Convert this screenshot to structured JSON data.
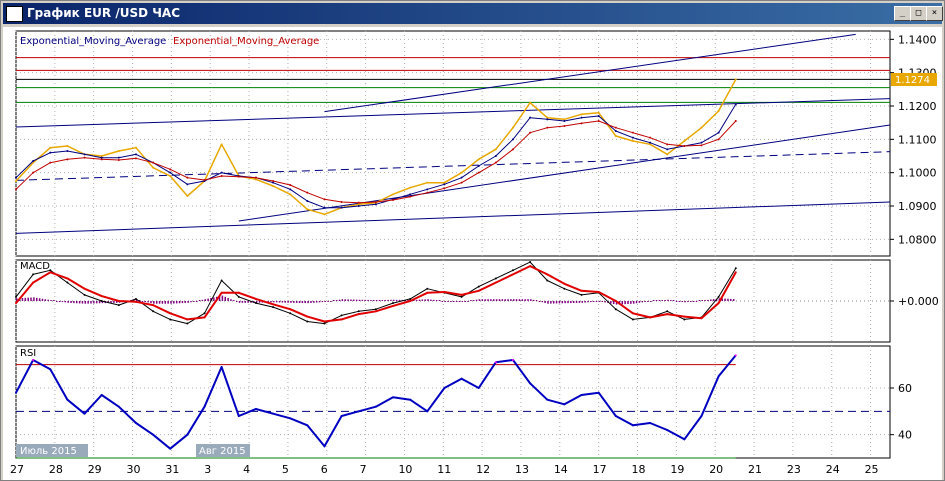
{
  "window": {
    "title": "График EUR /USD  ЧАС",
    "buttons": [
      "_",
      "□",
      "×"
    ]
  },
  "legend": {
    "ema1": "Exponential_Moving_Average",
    "ema2": "Exponential_Moving_Average"
  },
  "price_tag": "1.1274",
  "macd_label": "MACD",
  "rsi_label": "RSI",
  "month_labels": [
    "Июль 2015",
    "Авг 2015"
  ],
  "colors": {
    "price": "#e8a800",
    "ema_fast": "#000080",
    "ema_slow": "#c00000",
    "trend": "#000080",
    "macd_hist": "#800080",
    "rsi": "#0000c0",
    "rsi_extreme": "#ff00ff",
    "resist": "#c00000",
    "support": "#008000"
  },
  "chart_data": [
    {
      "type": "line",
      "name": "main",
      "ylim": [
        1.075,
        1.1425
      ],
      "yticks": [
        1.08,
        1.09,
        1.1,
        1.11,
        1.12,
        1.13,
        1.14
      ],
      "ytick_labels": [
        "1.0800",
        "1.0900",
        "1.1000",
        "1.1100",
        "1.1200",
        "1.1300",
        "1.1400"
      ],
      "horizontal_lines": [
        {
          "y": 1.1345,
          "color": "#c00000"
        },
        {
          "y": 1.1307,
          "color": "#c00000"
        },
        {
          "y": 1.128,
          "color": "#000000"
        },
        {
          "y": 1.1255,
          "color": "#008000"
        },
        {
          "y": 1.1211,
          "color": "#008000"
        }
      ],
      "trendlines": [
        {
          "x1": 0,
          "y1": 1.1137,
          "x2": 25.5,
          "y2": 1.1222,
          "dash": false
        },
        {
          "x1": 9,
          "y1": 1.1183,
          "x2": 24.5,
          "y2": 1.1415,
          "dash": false
        },
        {
          "x1": 0,
          "y1": 1.0818,
          "x2": 25.5,
          "y2": 1.0912,
          "dash": false
        },
        {
          "x1": 0,
          "y1": 1.0977,
          "x2": 25.5,
          "y2": 1.1063,
          "dash": true
        },
        {
          "x1": 6.5,
          "y1": 1.0855,
          "x2": 25.5,
          "y2": 1.1143,
          "dash": false
        }
      ],
      "x": [
        0,
        0.5,
        1,
        1.5,
        2,
        2.5,
        3,
        3.5,
        4,
        4.5,
        5,
        5.5,
        6,
        6.5,
        7,
        7.5,
        8,
        8.5,
        9,
        9.5,
        10,
        10.5,
        11,
        11.5,
        12,
        12.5,
        13,
        13.5,
        14,
        14.5,
        15,
        15.5,
        16,
        16.5,
        17,
        17.5,
        18,
        18.5,
        19,
        19.5,
        20,
        20.5,
        21
      ],
      "series": [
        {
          "values": [
            1.0975,
            1.103,
            1.1075,
            1.108,
            1.1055,
            1.105,
            1.1065,
            1.1075,
            1.1015,
            1.099,
            1.093,
            1.0975,
            1.1085,
            1.099,
            1.098,
            1.096,
            1.0935,
            1.089,
            1.0875,
            1.0895,
            1.0905,
            1.091,
            1.0935,
            1.0955,
            1.097,
            1.097,
            1.1,
            1.104,
            1.107,
            1.1135,
            1.121,
            1.1165,
            1.116,
            1.1175,
            1.118,
            1.111,
            1.1095,
            1.1085,
            1.1055,
            1.1095,
            1.1135,
            1.1185,
            1.128
          ]
        },
        {
          "values": [
            1.0985,
            1.1035,
            1.106,
            1.1065,
            1.1055,
            1.1045,
            1.1045,
            1.1055,
            1.103,
            1.1,
            1.0965,
            1.0975,
            1.1,
            1.099,
            1.0985,
            1.097,
            1.095,
            1.0915,
            1.0895,
            1.0895,
            1.09,
            1.0905,
            1.092,
            1.0935,
            1.095,
            1.0965,
            1.0985,
            1.102,
            1.105,
            1.11,
            1.1165,
            1.116,
            1.1155,
            1.1165,
            1.117,
            1.1125,
            1.1105,
            1.109,
            1.107,
            1.108,
            1.109,
            1.112,
            1.1205
          ]
        },
        {
          "values": [
            1.095,
            1.1,
            1.103,
            1.104,
            1.1045,
            1.104,
            1.1038,
            1.1043,
            1.103,
            1.101,
            1.0985,
            1.0978,
            1.099,
            1.0988,
            1.0985,
            1.0975,
            1.0963,
            1.094,
            1.092,
            1.0912,
            1.091,
            1.0912,
            1.0918,
            1.0928,
            1.094,
            1.0953,
            1.097,
            1.1,
            1.103,
            1.107,
            1.112,
            1.1135,
            1.114,
            1.1148,
            1.1155,
            1.1135,
            1.112,
            1.1105,
            1.1085,
            1.108,
            1.1082,
            1.11,
            1.1155
          ]
        }
      ]
    },
    {
      "type": "line",
      "name": "macd",
      "ylim": [
        -1,
        1
      ],
      "yticks": [
        0
      ],
      "ytick_labels": [
        "+0.000"
      ],
      "x": [
        0,
        0.5,
        1,
        1.5,
        2,
        2.5,
        3,
        3.5,
        4,
        4.5,
        5,
        5.5,
        6,
        6.5,
        7,
        7.5,
        8,
        8.5,
        9,
        9.5,
        10,
        10.5,
        11,
        11.5,
        12,
        12.5,
        13,
        13.5,
        14,
        14.5,
        15,
        15.5,
        16,
        16.5,
        17,
        17.5,
        18,
        18.5,
        19,
        19.5,
        20,
        20.5,
        21
      ],
      "series": [
        {
          "values": [
            0.1,
            0.65,
            0.75,
            0.45,
            0.15,
            0.0,
            -0.1,
            0.05,
            -0.25,
            -0.45,
            -0.55,
            -0.3,
            0.5,
            0.1,
            -0.05,
            -0.15,
            -0.3,
            -0.5,
            -0.55,
            -0.35,
            -0.25,
            -0.2,
            -0.05,
            0.05,
            0.3,
            0.2,
            0.1,
            0.35,
            0.55,
            0.75,
            0.95,
            0.5,
            0.3,
            0.15,
            0.2,
            -0.2,
            -0.45,
            -0.4,
            -0.25,
            -0.45,
            -0.4,
            0.1,
            0.8
          ]
        },
        {
          "values": [
            -0.05,
            0.45,
            0.7,
            0.55,
            0.3,
            0.12,
            0.0,
            -0.02,
            -0.1,
            -0.3,
            -0.45,
            -0.4,
            0.2,
            0.2,
            0.05,
            -0.08,
            -0.2,
            -0.38,
            -0.5,
            -0.45,
            -0.32,
            -0.25,
            -0.12,
            0.0,
            0.2,
            0.22,
            0.15,
            0.25,
            0.45,
            0.65,
            0.85,
            0.65,
            0.42,
            0.25,
            0.22,
            0.0,
            -0.3,
            -0.4,
            -0.32,
            -0.38,
            -0.42,
            -0.05,
            0.7
          ]
        }
      ]
    },
    {
      "type": "line",
      "name": "rsi",
      "ylim": [
        30,
        78
      ],
      "yticks": [
        40,
        60
      ],
      "ytick_labels": [
        "40",
        "60"
      ],
      "levels": [
        70,
        50,
        30
      ],
      "x": [
        0,
        0.5,
        1,
        1.5,
        2,
        2.5,
        3,
        3.5,
        4,
        4.5,
        5,
        5.5,
        6,
        6.5,
        7,
        7.5,
        8,
        8.5,
        9,
        9.5,
        10,
        10.5,
        11,
        11.5,
        12,
        12.5,
        13,
        13.5,
        14,
        14.5,
        15,
        15.5,
        16,
        16.5,
        17,
        17.5,
        18,
        18.5,
        19,
        19.5,
        20,
        20.5,
        21
      ],
      "series": [
        {
          "values": [
            58,
            72,
            68,
            55,
            49,
            57,
            52,
            45,
            40,
            34,
            40,
            52,
            69,
            48,
            51,
            49,
            47,
            44,
            35,
            48,
            50,
            52,
            56,
            55,
            50,
            60,
            64,
            60,
            71,
            72,
            62,
            55,
            53,
            57,
            58,
            48,
            44,
            45,
            42,
            38,
            48,
            65,
            74
          ]
        }
      ]
    }
  ],
  "x_axis_labels": [
    "27",
    "28",
    "29",
    "30",
    "31",
    "3",
    "4",
    "5",
    "6",
    "7",
    "10",
    "11",
    "12",
    "13",
    "14",
    "17",
    "18",
    "19",
    "20",
    "21",
    "23",
    "24",
    "25"
  ]
}
